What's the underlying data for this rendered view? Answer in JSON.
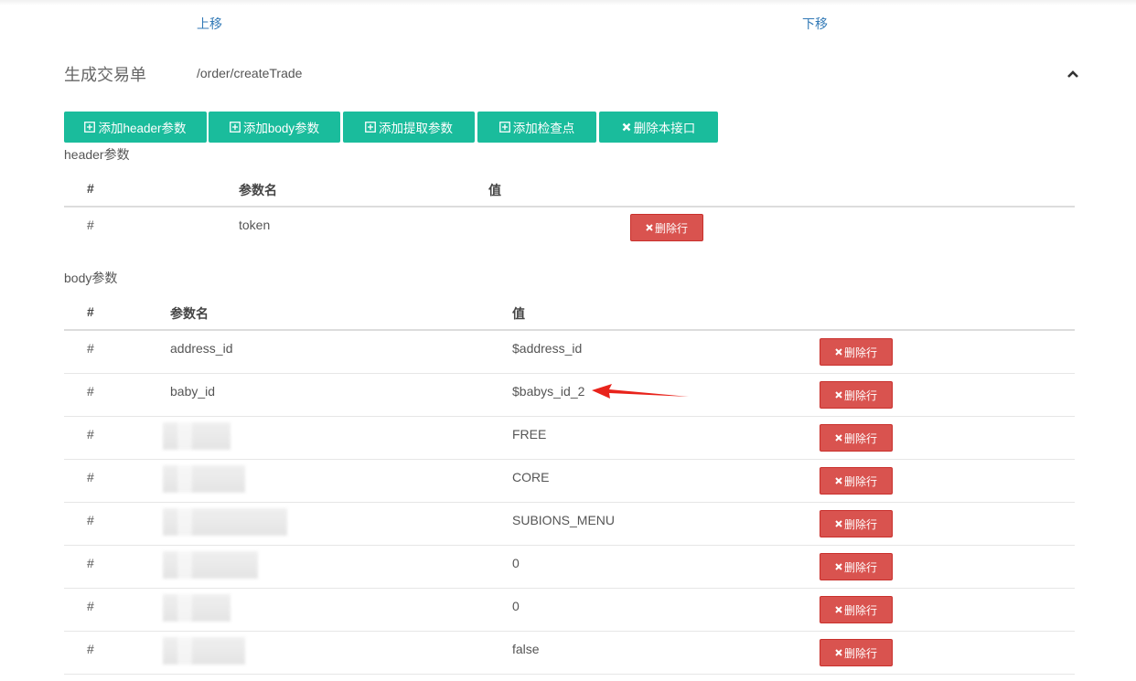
{
  "nav": {
    "move_up": "上移",
    "move_down": "下移"
  },
  "api": {
    "name": "生成交易单",
    "path": "/order/createTrade"
  },
  "toolbar": {
    "add_header": "添加header参数",
    "add_body": "添加body参数",
    "add_extract": "添加提取参数",
    "add_check": "添加检查点",
    "delete_api": "删除本接口"
  },
  "header_section": {
    "label": "header参数",
    "columns": {
      "index": "#",
      "name": "参数名",
      "value": "值"
    },
    "rows": [
      {
        "index": "#",
        "name": "token",
        "value": "",
        "delete": "删除行"
      }
    ]
  },
  "body_section": {
    "label": "body参数",
    "columns": {
      "index": "#",
      "name": "参数名",
      "value": "值"
    },
    "rows": [
      {
        "index": "#",
        "name": "address_id",
        "value": "$address_id",
        "delete": "删除行"
      },
      {
        "index": "#",
        "name": "baby_id",
        "value": "$babys_id_2",
        "delete": "删除行"
      },
      {
        "index": "#",
        "name": "",
        "value": "FREE",
        "delete": "删除行"
      },
      {
        "index": "#",
        "name": "",
        "value": "CORE",
        "delete": "删除行"
      },
      {
        "index": "#",
        "name": "",
        "value": "SUBIONS_MENU",
        "delete": "删除行"
      },
      {
        "index": "#",
        "name": "",
        "value": "0",
        "delete": "删除行"
      },
      {
        "index": "#",
        "name": "",
        "value": "0",
        "delete": "删除行"
      },
      {
        "index": "#",
        "name": "",
        "value": "false",
        "delete": "删除行"
      }
    ]
  },
  "colors": {
    "primary": "#1abc9c",
    "danger": "#d9534f",
    "link": "#337ab7",
    "annotation": "#e8231b"
  },
  "icons": {
    "add": "plus-square-icon",
    "remove": "times-icon",
    "collapse": "chevron-up-icon",
    "annotation": "red-arrow-icon"
  }
}
